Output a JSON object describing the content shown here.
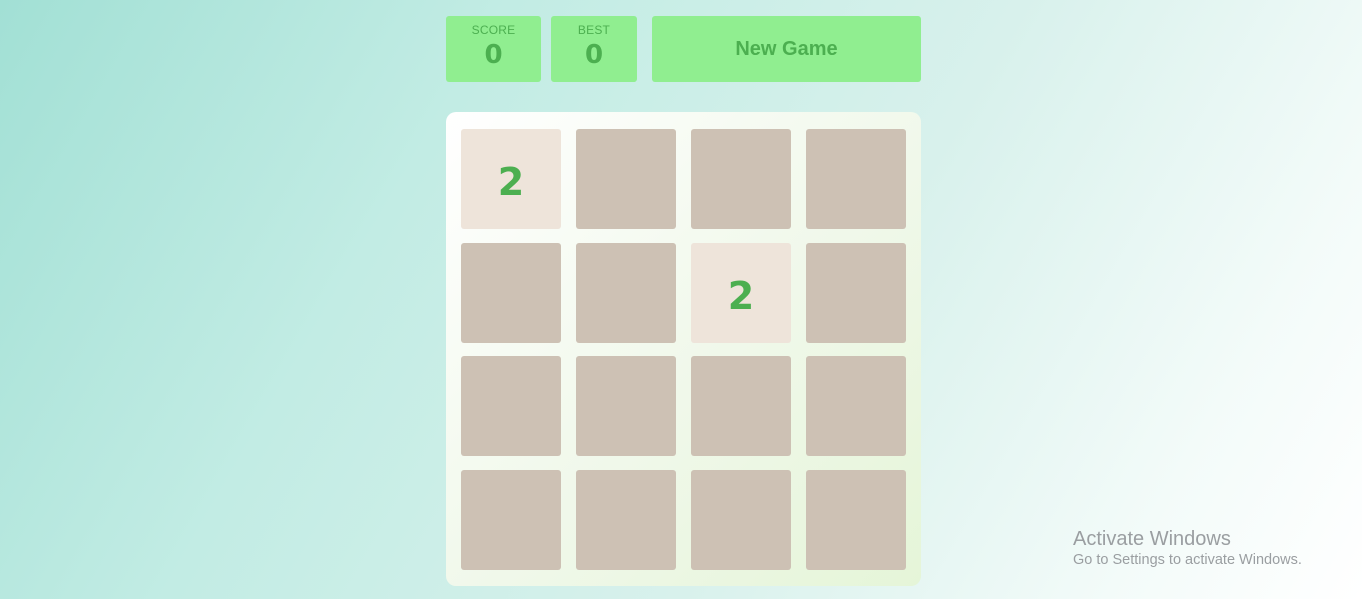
{
  "scoreboard": {
    "score_label": "SCORE",
    "score_value": "0",
    "best_label": "BEST",
    "best_value": "0"
  },
  "new_game_label": "New Game",
  "board": {
    "size": 4,
    "cells": [
      [
        "2",
        "",
        "",
        ""
      ],
      [
        "",
        "",
        "2",
        ""
      ],
      [
        "",
        "",
        "",
        ""
      ],
      [
        "",
        "",
        "",
        ""
      ]
    ]
  },
  "watermark": {
    "title": "Activate Windows",
    "subtitle": "Go to Settings to activate Windows."
  },
  "colors": {
    "accent_green": "#90ee90",
    "text_green": "#4caf50",
    "empty_tile": "#cdc1b4",
    "tile_2": "#eee4da"
  }
}
